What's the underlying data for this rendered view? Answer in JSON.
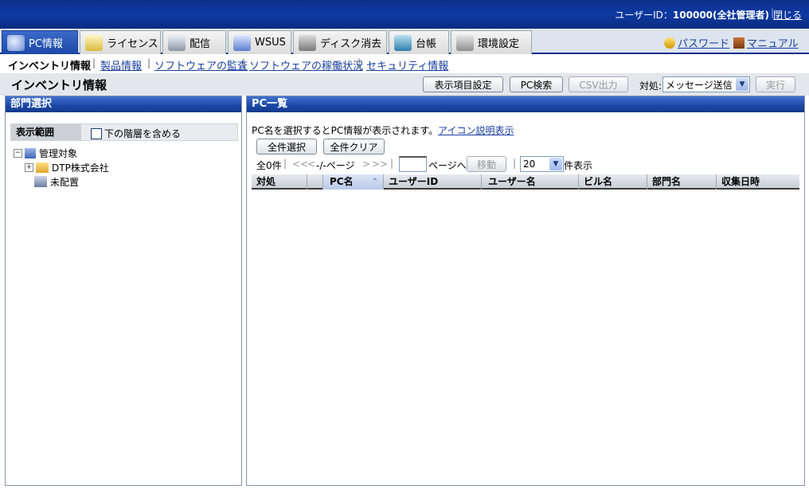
{
  "header": {
    "user_prefix": "ユーザーID：",
    "user_id": "100000(全社管理者)",
    "close": "閉じる"
  },
  "tabs": [
    {
      "label": "PC情報",
      "icon": "pc-network-icon",
      "active": true
    },
    {
      "label": "ライセンス",
      "icon": "license-certificate-icon"
    },
    {
      "label": "配信",
      "icon": "distribution-monitor-icon"
    },
    {
      "label": "WSUS",
      "icon": "wsus-icon"
    },
    {
      "label": "ディスク消去",
      "icon": "disk-erase-icon"
    },
    {
      "label": "台帳",
      "icon": "ledger-book-icon"
    },
    {
      "label": "環境設定",
      "icon": "settings-tools-icon"
    }
  ],
  "right_links": {
    "password": "パスワード",
    "manual": "マニュアル"
  },
  "subnav": [
    "インベントリ情報",
    "製品情報",
    "ソフトウェアの監査",
    "ソフトウェアの稼働状況",
    "セキュリティ情報"
  ],
  "page": {
    "title": "インベントリ情報",
    "btn_display_settings": "表示項目設定",
    "btn_pc_search": "PC検索",
    "btn_csv": "CSV出力",
    "action_label": "対処:",
    "action_value": "メッセージ送信",
    "btn_execute": "実行"
  },
  "left_panel": {
    "title": "部門選択",
    "scope_label": "表示範囲",
    "include_lower": "下の階層を含める",
    "tree": {
      "root": "管理対象",
      "company": "DTP株式会社",
      "unassigned": "未配置"
    }
  },
  "right_panel": {
    "title": "PC一覧",
    "info": "PC名を選択するとPC情報が表示されます。",
    "icon_help": "アイコン説明表示",
    "select_all": "全件選択",
    "clear_all": "全件クリア",
    "total": "全0件",
    "nav_first": "<<",
    "nav_prev": "<",
    "page_info": "-/-ページ",
    "nav_next": ">",
    "nav_last": ">>",
    "page_to": "ページへ",
    "move": "移動",
    "per_page": "20",
    "per_page_suffix": "件表示",
    "columns": [
      "対処",
      "",
      "PC名",
      "ユーザーID",
      "ユーザー名",
      "ビル名",
      "部門名",
      "収集日時"
    ]
  },
  "colors": {
    "header_blue": "#0d3aa3",
    "link": "#1a3fa0",
    "panel_head": "#1a47a6"
  }
}
